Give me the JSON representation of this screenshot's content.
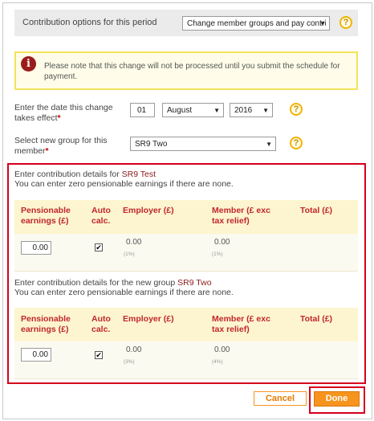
{
  "contribution_options": {
    "label": "Contribution options for this period",
    "selected": "Change member groups and pay contri"
  },
  "notice": {
    "icon": "info-icon",
    "text": "Please note that this change will not be processed until you submit the schedule for payment."
  },
  "effective_date": {
    "label": "Enter the date this change takes effect",
    "required_marker": "*",
    "day": "01",
    "month": "August",
    "year": "2016"
  },
  "new_group": {
    "label": "Select new group for this member",
    "required_marker": "*",
    "selected": "SR9 Two"
  },
  "section_current": {
    "intro_prefix": "Enter contribution details for ",
    "group_name": "SR9 Test",
    "subtext": "You can enter zero pensionable earnings if there are none.",
    "columns": [
      "Pensionable earnings (£)",
      "Auto calc.",
      "Employer (£)",
      "Member (£ exc tax relief)",
      "Total (£)"
    ],
    "earnings": "0.00",
    "auto_calc": true,
    "employer_value": "0.00",
    "employer_pct": "(1%)",
    "member_value": "0.00",
    "member_pct": "(1%)"
  },
  "section_new": {
    "intro_prefix": "Enter contribution details for the new group ",
    "group_name": "SR9 Two",
    "subtext": "You can enter zero pensionable earnings if there are none.",
    "columns": [
      "Pensionable earnings (£)",
      "Auto calc.",
      "Employer (£)",
      "Member (£ exc tax relief)",
      "Total (£)"
    ],
    "earnings": "0.00",
    "auto_calc": true,
    "employer_value": "0.00",
    "employer_pct": "(3%)",
    "member_value": "0.00",
    "member_pct": "(4%)"
  },
  "buttons": {
    "cancel": "Cancel",
    "done": "Done"
  },
  "colors": {
    "highlight_border": "#d6001c",
    "accent_orange": "#f7941d",
    "table_header_bg": "#fdf5cf"
  }
}
